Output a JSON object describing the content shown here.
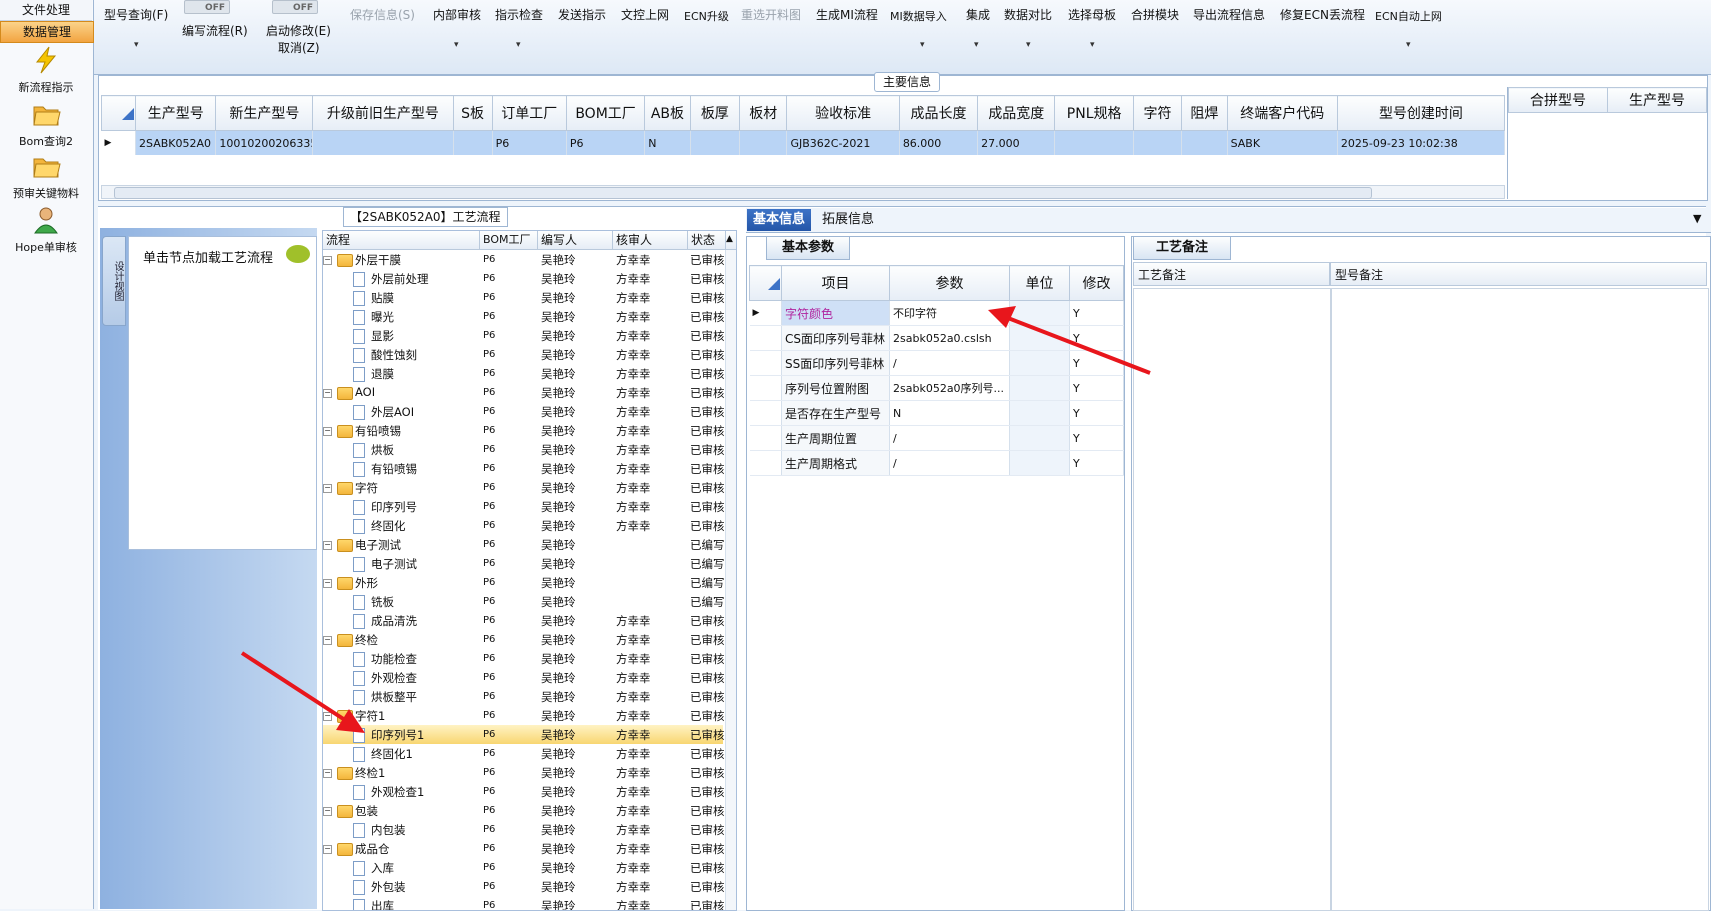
{
  "nav": {
    "file_tab": "文件处理",
    "data_tab": "数据管理",
    "items": [
      "新流程指示",
      "Bom查询2",
      "预审关键物料",
      "Hope单审核"
    ]
  },
  "toolbar": {
    "model_query": "型号查询(F)",
    "write_flow": "编写流程(R)",
    "start_modify": "启动修改(E)",
    "cancel": "取消(Z)",
    "toggle_off": "OFF",
    "save_info": "保存信息(S)",
    "internal_review": "内部审核",
    "instruct_check": "指示检查",
    "send_instruct": "发送指示",
    "doc_online": "文控上网",
    "ecn_upgrade": "ECN升级",
    "reselect_open": "重选开料图",
    "gen_mi": "生成MI流程",
    "mi_import": "MI数据导入",
    "integrate": "集成",
    "data_compare": "数据对比",
    "select_mother": "选择母板",
    "merge_module": "合拼模块",
    "export_flow": "导出流程信息",
    "repair_ecn": "修复ECN丢流程",
    "ecn_auto": "ECN自动上网"
  },
  "main_info": {
    "title": "主要信息",
    "columns": [
      "生产型号",
      "新生产型号",
      "升级前旧生产型号",
      "S板",
      "订单工厂",
      "BOM工厂",
      "AB板",
      "板厚",
      "板材",
      "验收标准",
      "成品长度",
      "成品宽度",
      "PNL规格",
      "字符",
      "阻焊",
      "终端客户代码",
      "型号创建时间"
    ],
    "row": [
      "2SABK052A0",
      "10010200206335",
      "",
      "",
      "P6",
      "P6",
      "N",
      "",
      "",
      "GJB362C-2021",
      "86.000",
      "27.000",
      "",
      "",
      "",
      "SABK",
      "2025-09-23 10:02:38"
    ],
    "merge_columns": [
      "合拼型号",
      "生产型号"
    ]
  },
  "flow": {
    "title": "【2SABK052A0】工艺流程",
    "side_tab": "设计视图",
    "hint": "单击节点加载工艺流程",
    "columns": [
      "流程",
      "BOM工厂",
      "编写人",
      "核审人",
      "状态"
    ],
    "rows": [
      {
        "name": "外层干膜",
        "type": "folder",
        "bom": "P6",
        "writer": "吴艳玲",
        "reviewer": "方幸幸",
        "status": "已审核"
      },
      {
        "name": "外层前处理",
        "type": "file",
        "bom": "P6",
        "writer": "吴艳玲",
        "reviewer": "方幸幸",
        "status": "已审核"
      },
      {
        "name": "贴膜",
        "type": "file",
        "bom": "P6",
        "writer": "吴艳玲",
        "reviewer": "方幸幸",
        "status": "已审核"
      },
      {
        "name": "曝光",
        "type": "file",
        "bom": "P6",
        "writer": "吴艳玲",
        "reviewer": "方幸幸",
        "status": "已审核"
      },
      {
        "name": "显影",
        "type": "file",
        "bom": "P6",
        "writer": "吴艳玲",
        "reviewer": "方幸幸",
        "status": "已审核"
      },
      {
        "name": "酸性蚀刻",
        "type": "file",
        "bom": "P6",
        "writer": "吴艳玲",
        "reviewer": "方幸幸",
        "status": "已审核"
      },
      {
        "name": "退膜",
        "type": "file",
        "bom": "P6",
        "writer": "吴艳玲",
        "reviewer": "方幸幸",
        "status": "已审核"
      },
      {
        "name": "AOI",
        "type": "folder",
        "bom": "P6",
        "writer": "吴艳玲",
        "reviewer": "方幸幸",
        "status": "已审核"
      },
      {
        "name": "外层AOI",
        "type": "file",
        "bom": "P6",
        "writer": "吴艳玲",
        "reviewer": "方幸幸",
        "status": "已审核"
      },
      {
        "name": "有铅喷锡",
        "type": "folder",
        "bom": "P6",
        "writer": "吴艳玲",
        "reviewer": "方幸幸",
        "status": "已审核"
      },
      {
        "name": "烘板",
        "type": "file",
        "bom": "P6",
        "writer": "吴艳玲",
        "reviewer": "方幸幸",
        "status": "已审核"
      },
      {
        "name": "有铅喷锡",
        "type": "file",
        "bom": "P6",
        "writer": "吴艳玲",
        "reviewer": "方幸幸",
        "status": "已审核"
      },
      {
        "name": "字符",
        "type": "folder",
        "bom": "P6",
        "writer": "吴艳玲",
        "reviewer": "方幸幸",
        "status": "已审核"
      },
      {
        "name": "印序列号",
        "type": "file",
        "bom": "P6",
        "writer": "吴艳玲",
        "reviewer": "方幸幸",
        "status": "已审核"
      },
      {
        "name": "终固化",
        "type": "file",
        "bom": "P6",
        "writer": "吴艳玲",
        "reviewer": "方幸幸",
        "status": "已审核"
      },
      {
        "name": "电子测试",
        "type": "folder",
        "bom": "P6",
        "writer": "吴艳玲",
        "reviewer": "",
        "status": "已编写"
      },
      {
        "name": "电子测试",
        "type": "file",
        "bom": "P6",
        "writer": "吴艳玲",
        "reviewer": "",
        "status": "已编写"
      },
      {
        "name": "外形",
        "type": "folder",
        "bom": "P6",
        "writer": "吴艳玲",
        "reviewer": "",
        "status": "已编写"
      },
      {
        "name": "铣板",
        "type": "file",
        "bom": "P6",
        "writer": "吴艳玲",
        "reviewer": "",
        "status": "已编写"
      },
      {
        "name": "成品清洗",
        "type": "file",
        "bom": "P6",
        "writer": "吴艳玲",
        "reviewer": "方幸幸",
        "status": "已审核"
      },
      {
        "name": "终检",
        "type": "folder",
        "bom": "P6",
        "writer": "吴艳玲",
        "reviewer": "方幸幸",
        "status": "已审核"
      },
      {
        "name": "功能检查",
        "type": "file",
        "bom": "P6",
        "writer": "吴艳玲",
        "reviewer": "方幸幸",
        "status": "已审核"
      },
      {
        "name": "外观检查",
        "type": "file",
        "bom": "P6",
        "writer": "吴艳玲",
        "reviewer": "方幸幸",
        "status": "已审核"
      },
      {
        "name": "烘板整平",
        "type": "file",
        "bom": "P6",
        "writer": "吴艳玲",
        "reviewer": "方幸幸",
        "status": "已审核"
      },
      {
        "name": "字符1",
        "type": "folder",
        "bom": "P6",
        "writer": "吴艳玲",
        "reviewer": "方幸幸",
        "status": "已审核"
      },
      {
        "name": "印序列号1",
        "type": "file",
        "bom": "P6",
        "writer": "吴艳玲",
        "reviewer": "方幸幸",
        "status": "已审核",
        "selected": true
      },
      {
        "name": "终固化1",
        "type": "file",
        "bom": "P6",
        "writer": "吴艳玲",
        "reviewer": "方幸幸",
        "status": "已审核"
      },
      {
        "name": "终检1",
        "type": "folder",
        "bom": "P6",
        "writer": "吴艳玲",
        "reviewer": "方幸幸",
        "status": "已审核"
      },
      {
        "name": "外观检查1",
        "type": "file",
        "bom": "P6",
        "writer": "吴艳玲",
        "reviewer": "方幸幸",
        "status": "已审核"
      },
      {
        "name": "包装",
        "type": "folder",
        "bom": "P6",
        "writer": "吴艳玲",
        "reviewer": "方幸幸",
        "status": "已审核"
      },
      {
        "name": "内包装",
        "type": "file",
        "bom": "P6",
        "writer": "吴艳玲",
        "reviewer": "方幸幸",
        "status": "已审核"
      },
      {
        "name": "成品仓",
        "type": "folder",
        "bom": "P6",
        "writer": "吴艳玲",
        "reviewer": "方幸幸",
        "status": "已审核"
      },
      {
        "name": "入库",
        "type": "file",
        "bom": "P6",
        "writer": "吴艳玲",
        "reviewer": "方幸幸",
        "status": "已审核"
      },
      {
        "name": "外包装",
        "type": "file",
        "bom": "P6",
        "writer": "吴艳玲",
        "reviewer": "方幸幸",
        "status": "已审核"
      },
      {
        "name": "出库",
        "type": "file",
        "bom": "P6",
        "writer": "吴艳玲",
        "reviewer": "方幸幸",
        "status": "已审核"
      }
    ]
  },
  "tabs": {
    "basic": "基本信息",
    "extended": "拓展信息"
  },
  "params": {
    "title": "基本参数",
    "columns": [
      "项目",
      "参数",
      "单位",
      "修改"
    ],
    "rows": [
      {
        "item": "字符颜色",
        "value": "不印字符",
        "unit": "",
        "modify": "Y",
        "highlight": true
      },
      {
        "item": "CS面印序列号菲林",
        "value": "2sabk052a0.cslsh",
        "unit": "",
        "modify": "Y"
      },
      {
        "item": "SS面印序列号菲林",
        "value": "/",
        "unit": "",
        "modify": "Y"
      },
      {
        "item": "序列号位置附图",
        "value": "2sabk052a0序列号...",
        "unit": "",
        "modify": "Y"
      },
      {
        "item": "是否存在生产型号",
        "value": "N",
        "unit": "",
        "modify": "Y"
      },
      {
        "item": "生产周期位置",
        "value": "/",
        "unit": "",
        "modify": "Y"
      },
      {
        "item": "生产周期格式",
        "value": "/",
        "unit": "",
        "modify": "Y"
      }
    ]
  },
  "notes": {
    "title": "工艺备注",
    "process_note": "工艺备注",
    "model_note": "型号备注"
  },
  "colors": {
    "accent": "#2456a8",
    "selection": "#b9d4f5",
    "highlight_row": "#f8d671",
    "label_magenta": "#b0249f",
    "arrow": "#e8161c"
  }
}
